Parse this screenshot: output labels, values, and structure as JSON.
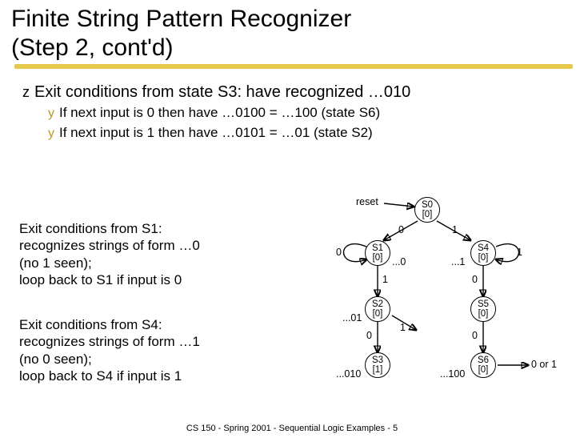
{
  "title_line1": "Finite String Pattern Recognizer",
  "title_line2": "(Step 2, cont'd)",
  "bullet_main": "Exit conditions from state S3: have recognized …010",
  "sub1": "If next input is 0 then have …0100 = …100 (state S6)",
  "sub2": "If next input is 1 then have …0101 = …01 (state S2)",
  "note1": "Exit conditions from S1:\nrecognizes strings of form …0\n(no 1 seen);\nloop back to S1 if input is 0",
  "note2": "Exit conditions from S4:\nrecognizes strings of form …1\n(no 0 seen);\nloop back to S4 if input is 1",
  "diagram": {
    "reset": "reset",
    "s0": {
      "name": "S0",
      "out": "[0]"
    },
    "s1": {
      "name": "S1",
      "out": "[0]",
      "seq": "...0"
    },
    "s2": {
      "name": "S2",
      "out": "[0]",
      "seq": "...01"
    },
    "s3": {
      "name": "S3",
      "out": "[1]",
      "seq": "...010"
    },
    "s4": {
      "name": "S4",
      "out": "[0]",
      "seq": "...1"
    },
    "s5": {
      "name": "S5",
      "out": "[0]"
    },
    "s6": {
      "name": "S6",
      "out": "[0]",
      "seq": "...100"
    },
    "edge01": "0",
    "edge11": "1",
    "edge_loop0": "0",
    "edge_loop1": "1",
    "e_s1_s2": "1",
    "e_s4_s5": "0",
    "e_s2_s3_0": "0",
    "e_s2_1": "1",
    "e_s5_0": "0",
    "right_out": "0 or 1"
  },
  "footer": "CS 150 - Spring 2001 - Sequential Logic Examples - 5"
}
